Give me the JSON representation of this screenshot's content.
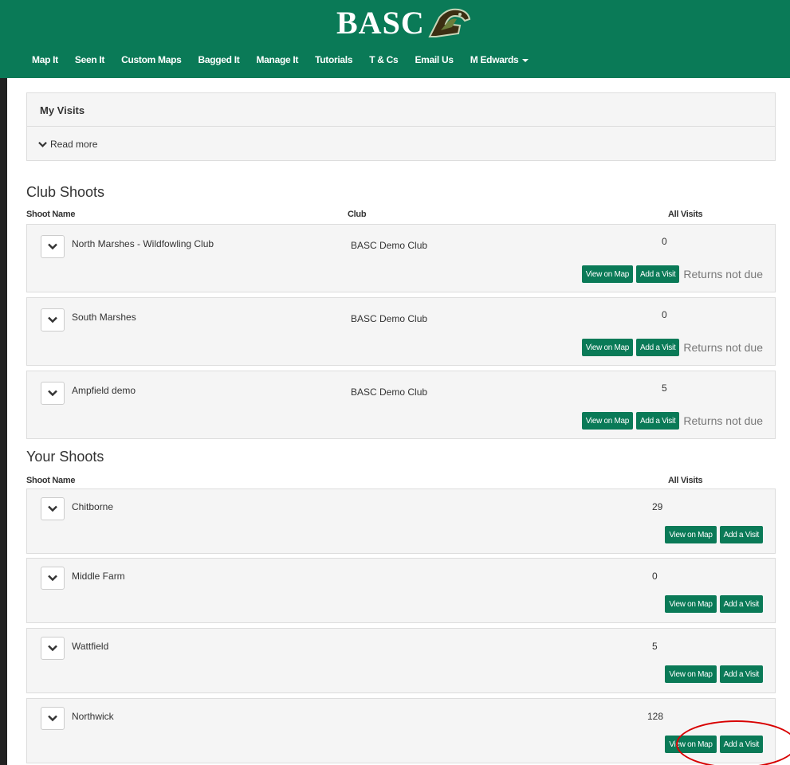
{
  "brand": {
    "logo_text": "BASC"
  },
  "nav": {
    "items": [
      "Map It",
      "Seen It",
      "Custom Maps",
      "Bagged It",
      "Manage It",
      "Tutorials",
      "T & Cs",
      "Email Us"
    ],
    "user": "M Edwards"
  },
  "my_visits": {
    "title": "My Visits",
    "read_more": "Read more"
  },
  "club_shoots": {
    "title": "Club Shoots",
    "headers": {
      "name": "Shoot Name",
      "club": "Club",
      "visits": "All Visits"
    },
    "rows": [
      {
        "name": "North Marshes - Wildfowling Club",
        "club": "BASC Demo Club",
        "visits": "0",
        "status": "Returns not due"
      },
      {
        "name": "South Marshes",
        "club": "BASC Demo Club",
        "visits": "0",
        "status": "Returns not due"
      },
      {
        "name": "Ampfield demo",
        "club": "BASC Demo Club",
        "visits": "5",
        "status": "Returns not due"
      }
    ]
  },
  "your_shoots": {
    "title": "Your Shoots",
    "headers": {
      "name": "Shoot Name",
      "visits": "All Visits"
    },
    "rows": [
      {
        "name": "Chitborne",
        "visits": "29"
      },
      {
        "name": "Middle Farm",
        "visits": "0"
      },
      {
        "name": "Wattfield",
        "visits": "5"
      },
      {
        "name": "Northwick",
        "visits": "128"
      }
    ]
  },
  "buttons": {
    "view_on_map": "View on Map",
    "add_visit": "Add a Visit"
  },
  "colors": {
    "brand_green": "#0a7a57",
    "annotation_red": "#d80000"
  }
}
